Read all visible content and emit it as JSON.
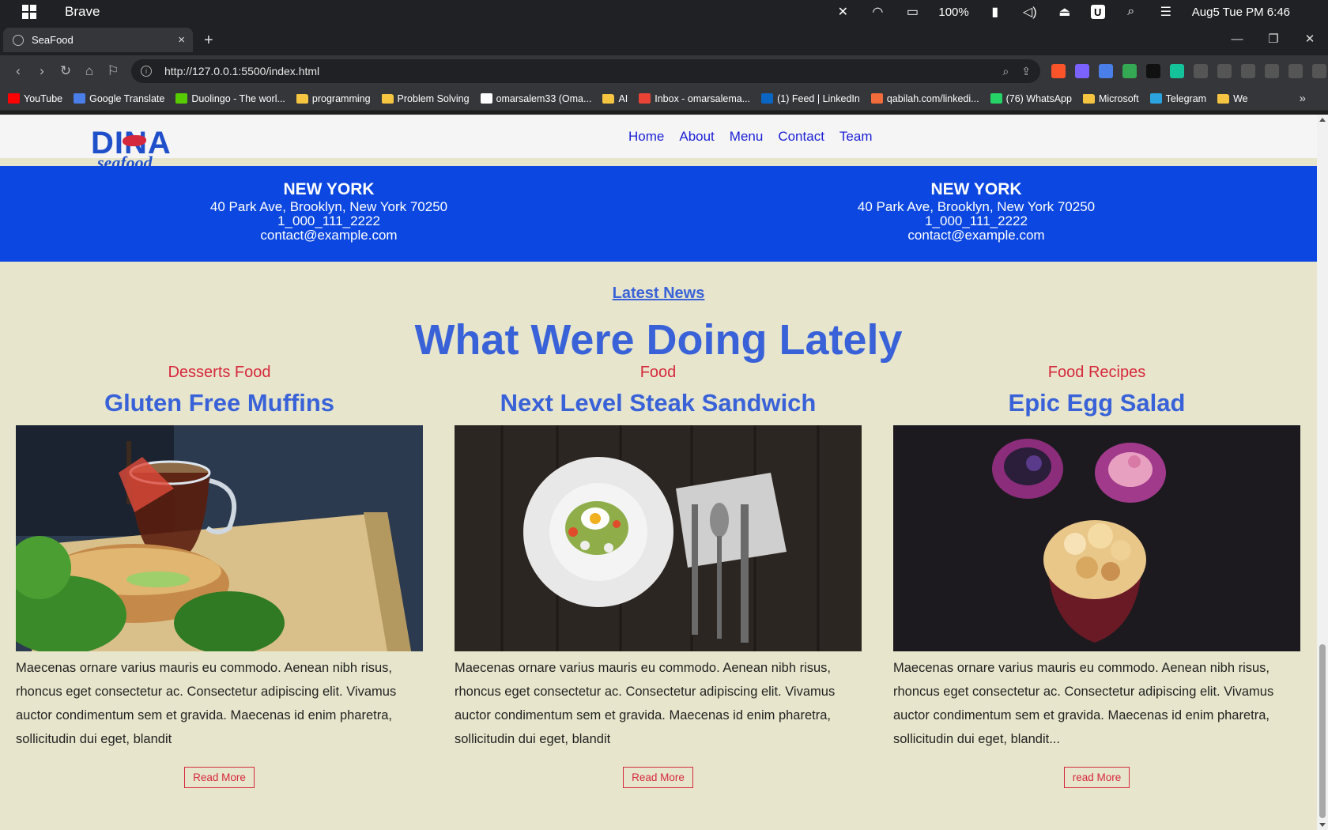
{
  "os": {
    "app_name": "Brave",
    "battery": "100%",
    "datetime": "Aug5 Tue PM 6:46",
    "u_badge": "U"
  },
  "browser": {
    "tab_title": "SeaFood",
    "tab_close": "×",
    "new_tab": "+",
    "url": "http://127.0.0.1:5500/index.html",
    "bookmarks": [
      {
        "label": "YouTube",
        "type": "site",
        "color": "#ff0000"
      },
      {
        "label": "Google Translate",
        "type": "site",
        "color": "#4a7ee8"
      },
      {
        "label": "Duolingo - The worl...",
        "type": "site",
        "color": "#58cc02"
      },
      {
        "label": "programming",
        "type": "folder"
      },
      {
        "label": "Problem Solving",
        "type": "folder"
      },
      {
        "label": "omarsalem33 (Oma...",
        "type": "site",
        "color": "#ffffff"
      },
      {
        "label": "AI",
        "type": "folder"
      },
      {
        "label": "Inbox - omarsalema...",
        "type": "site",
        "color": "#ea4335"
      },
      {
        "label": "(1) Feed | LinkedIn",
        "type": "site",
        "color": "#0a66c2"
      },
      {
        "label": "qabilah.com/linkedi...",
        "type": "site",
        "color": "#f26b3a"
      },
      {
        "label": "(76) WhatsApp",
        "type": "site",
        "color": "#25d366"
      },
      {
        "label": "Microsoft",
        "type": "folder"
      },
      {
        "label": "Telegram",
        "type": "site",
        "color": "#2aa3df"
      },
      {
        "label": "We",
        "type": "folder"
      }
    ]
  },
  "site": {
    "nav": [
      "Home",
      "About",
      "Menu",
      "Contact",
      "Team"
    ],
    "logo": {
      "top": "DINA",
      "bottom": "seafood"
    },
    "contacts": [
      {
        "city": "NEW YORK",
        "address": "40 Park Ave, Brooklyn, New York 70250",
        "phone": "1_000_111_2222",
        "email": "contact@example.com"
      },
      {
        "city": "NEW YORK",
        "address": "40 Park Ave, Brooklyn, New York 70250",
        "phone": "1_000_111_2222",
        "email": "contact@example.com"
      }
    ],
    "news_label": "Latest News",
    "news_title": "What Were Doing Lately",
    "cards": [
      {
        "category": "Desserts Food",
        "title": "Gluten Free Muffins",
        "description": "Maecenas ornare varius mauris eu commodo. Aenean nibh risus, rhoncus eget consectetur ac. Consectetur adipiscing elit. Vivamus auctor condimentum sem et gravida. Maecenas id enim pharetra, sollicitudin dui eget, blandit",
        "button": "Read More"
      },
      {
        "category": "Food",
        "title": "Next Level Steak Sandwich",
        "description": "Maecenas ornare varius mauris eu commodo. Aenean nibh risus, rhoncus eget consectetur ac. Consectetur adipiscing elit. Vivamus auctor condimentum sem et gravida. Maecenas id enim pharetra, sollicitudin dui eget, blandit",
        "button": "Read More"
      },
      {
        "category": "Food Recipes",
        "title": "Epic Egg Salad",
        "description": "Maecenas ornare varius mauris eu commodo. Aenean nibh risus, rhoncus eget consectetur ac. Consectetur adipiscing elit. Vivamus auctor condimentum sem et gravida. Maecenas id enim pharetra, sollicitudin dui eget, blandit...",
        "button": "read More"
      }
    ]
  }
}
